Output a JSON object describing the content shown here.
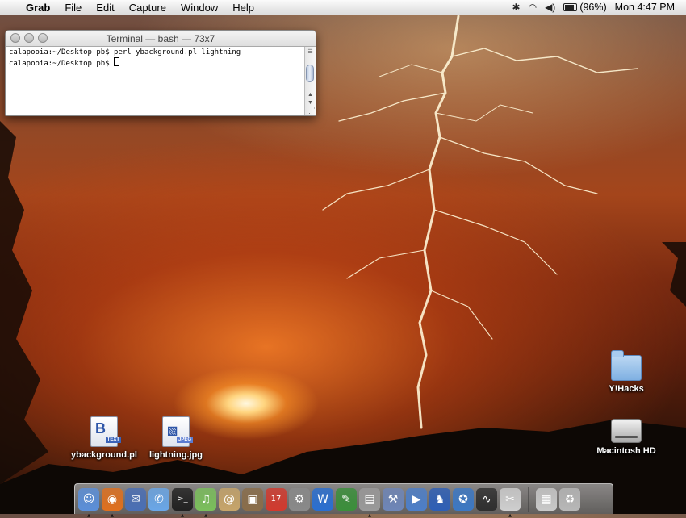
{
  "menubar": {
    "app_name": "Grab",
    "items": [
      "File",
      "Edit",
      "Capture",
      "Window",
      "Help"
    ],
    "battery_text": "(96%)",
    "clock": "Mon 4:47 PM"
  },
  "terminal": {
    "title": "Terminal — bash — 73x7",
    "lines": [
      "calapooia:~/Desktop pb$ perl ybackground.pl lightning",
      "calapooia:~/Desktop pb$ "
    ]
  },
  "desktop_icons": [
    {
      "label": "ybackground.pl",
      "icon": "perl-document-icon",
      "badge": "TEXT"
    },
    {
      "label": "lightning.jpg",
      "icon": "jpeg-document-icon",
      "badge": "JPEG"
    },
    {
      "label": "Y!Hacks",
      "icon": "folder-icon"
    },
    {
      "label": "Macintosh HD",
      "icon": "hard-drive-icon"
    }
  ],
  "dock": {
    "items": [
      {
        "name": "finder-icon",
        "glyph": "☺",
        "color": "#5b8fd9",
        "running": true
      },
      {
        "name": "firefox-icon",
        "glyph": "◉",
        "color": "#e0701e",
        "running": true
      },
      {
        "name": "thunderbird-icon",
        "glyph": "✉",
        "color": "#4a6fb5",
        "running": false
      },
      {
        "name": "ichat-icon",
        "glyph": "✆",
        "color": "#6aa7e8",
        "running": false
      },
      {
        "name": "terminal-icon",
        "glyph": ">_",
        "color": "#222222",
        "running": true
      },
      {
        "name": "itunes-icon",
        "glyph": "♫",
        "color": "#7bbf5c",
        "running": true
      },
      {
        "name": "address-book-icon",
        "glyph": "@",
        "color": "#c7a56a",
        "running": false
      },
      {
        "name": "iphoto-icon",
        "glyph": "▣",
        "color": "#8a6d4a",
        "running": false
      },
      {
        "name": "ical-icon",
        "glyph": "17",
        "color": "#d23a2e",
        "running": false
      },
      {
        "name": "system-preferences-icon",
        "glyph": "⚙",
        "color": "#8a8a8a",
        "running": false
      },
      {
        "name": "word-icon",
        "glyph": "W",
        "color": "#2a6fd1",
        "running": false
      },
      {
        "name": "script-editor-icon",
        "glyph": "✎",
        "color": "#3b8f3b",
        "running": false
      },
      {
        "name": "preview-icon",
        "glyph": "▤",
        "color": "#9a9a9a",
        "running": true
      },
      {
        "name": "xcode-icon",
        "glyph": "⚒",
        "color": "#6e86b8",
        "running": false
      },
      {
        "name": "mplayer-icon",
        "glyph": "▶",
        "color": "#4d7fc9",
        "running": false
      },
      {
        "name": "cyberduck-icon",
        "glyph": "♞",
        "color": "#2e5fb6",
        "running": false
      },
      {
        "name": "fugu-icon",
        "glyph": "✪",
        "color": "#3c78c4",
        "running": false
      },
      {
        "name": "activity-monitor-icon",
        "glyph": "∿",
        "color": "#2f2f2f",
        "running": false
      },
      {
        "name": "grab-icon",
        "glyph": "✂",
        "color": "#cfcfcf",
        "running": true
      }
    ],
    "right_items": [
      {
        "name": "documents-stack-icon",
        "glyph": "▦",
        "color": "#c9c9c9"
      },
      {
        "name": "trash-icon",
        "glyph": "♻",
        "color": "#b8b8b8"
      }
    ]
  }
}
